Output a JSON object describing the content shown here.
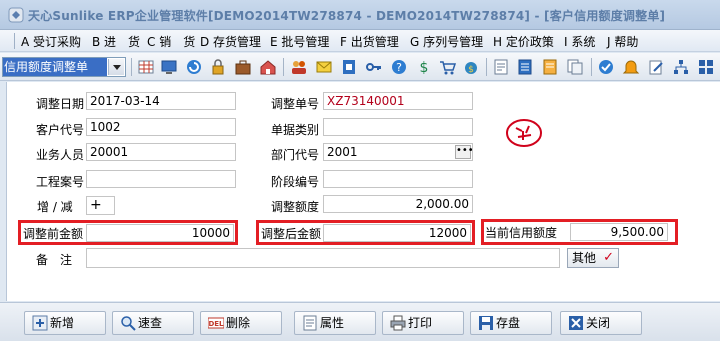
{
  "window": {
    "title": "天心Sunlike ERP企业管理软件[DEMO2014TW278874 - DEMO2014TW278874] - [客户信用额度调整单]"
  },
  "menu": {
    "items": [
      {
        "label": "A 受订采购"
      },
      {
        "label": "B 进　货"
      },
      {
        "label": "C 销　货"
      },
      {
        "label": "D 存货管理"
      },
      {
        "label": "E 批号管理"
      },
      {
        "label": "F 出货管理"
      },
      {
        "label": "G 序列号管理"
      },
      {
        "label": "H 定价政策"
      },
      {
        "label": "I 系统"
      },
      {
        "label": "J 帮助"
      }
    ]
  },
  "toolbar": {
    "selected_form": "信用额度调整单",
    "icons": [
      "grid-icon",
      "monitor-icon",
      "refresh-icon",
      "lock-icon",
      "briefcase-icon",
      "house-icon",
      "people-icon",
      "mail-icon",
      "document-blue-icon",
      "key-icon",
      "help-icon",
      "money-icon",
      "cart-icon",
      "money-bag-icon",
      "report-icon",
      "notepad-icon",
      "document-icon",
      "copy-icon",
      "check-circle-icon",
      "bell-icon",
      "edit-icon",
      "tree-icon",
      "tiles-icon"
    ]
  },
  "form": {
    "adjust_date": {
      "label": "调整日期",
      "value": "2017-03-14"
    },
    "adjust_no": {
      "label": "调整单号",
      "value": "XZ73140001"
    },
    "customer_code": {
      "label": "客户代号",
      "value": "1002"
    },
    "doc_category": {
      "label": "单据类别",
      "value": ""
    },
    "salesperson": {
      "label": "业务人员",
      "value": "20001"
    },
    "dept_code": {
      "label": "部门代号",
      "value": "2001"
    },
    "project_no": {
      "label": "工程案号",
      "value": ""
    },
    "stage_no": {
      "label": "阶段编号",
      "value": ""
    },
    "increase_decrease": {
      "label": "增 / 减",
      "value": "+"
    },
    "adjust_amount": {
      "label": "调整额度",
      "value": "2,000.00"
    },
    "before_amount": {
      "label": "调整前金额",
      "value": "10000"
    },
    "after_amount": {
      "label": "调整后金额",
      "value": "12000"
    },
    "current_credit": {
      "label": "当前信用额度",
      "value": "9,500.00"
    },
    "remark": {
      "label": "备　注",
      "value": ""
    },
    "other_button": "其他",
    "stamp_text": "检"
  },
  "buttons": {
    "add": "新增",
    "quick_search": "速查",
    "delete": "删除",
    "properties": "属性",
    "print": "打印",
    "save": "存盘",
    "close": "关闭"
  },
  "colors": {
    "highlight_box": "#e31e24",
    "selection": "#3a6ec5",
    "doc_number": "#b3001b"
  }
}
